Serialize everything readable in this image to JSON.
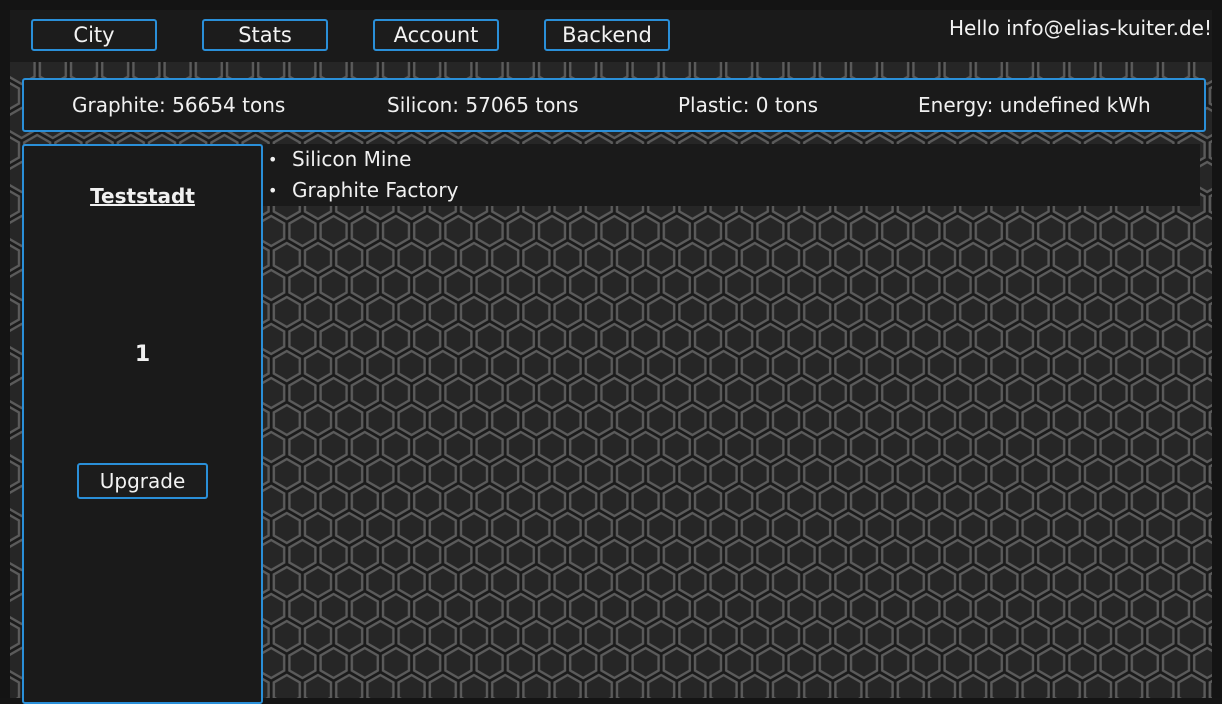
{
  "nav": {
    "items": [
      {
        "label": "City"
      },
      {
        "label": "Stats"
      },
      {
        "label": "Account"
      },
      {
        "label": "Backend"
      }
    ],
    "greeting": "Hello info@elias-kuiter.de!"
  },
  "resources": {
    "graphite": "Graphite: 56654 tons",
    "silicon": "Silicon: 57065 tons",
    "plastic": "Plastic: 0 tons",
    "energy": "Energy: undefined kWh"
  },
  "city": {
    "name": "Teststadt",
    "level": "1",
    "upgrade_label": "Upgrade"
  },
  "buildings": [
    {
      "label": "Silicon Mine"
    },
    {
      "label": "Graphite Factory"
    }
  ],
  "colors": {
    "accent": "#2a8fd8",
    "panel": "#1a1a1a",
    "text": "#f0f0f0"
  }
}
